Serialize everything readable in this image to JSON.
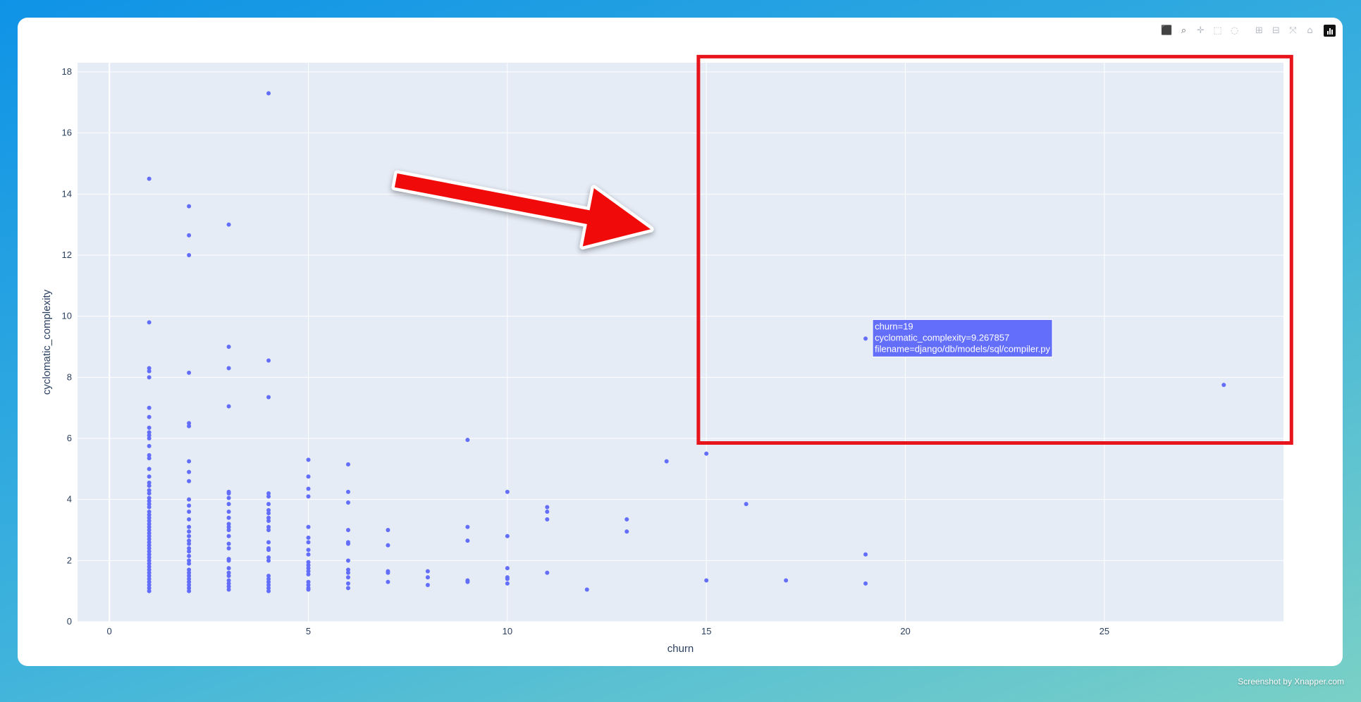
{
  "modebar": {
    "buttons": [
      {
        "name": "camera-icon",
        "glyph": "⬛"
      },
      {
        "name": "zoom-icon",
        "glyph": "⌕"
      },
      {
        "name": "pan-icon",
        "glyph": "✛"
      },
      {
        "name": "box-select-icon",
        "glyph": "⬚"
      },
      {
        "name": "lasso-select-icon",
        "glyph": "◌"
      },
      {
        "name": "zoom-in-icon",
        "glyph": "⊞"
      },
      {
        "name": "zoom-out-icon",
        "glyph": "⊟"
      },
      {
        "name": "autoscale-icon",
        "glyph": "⤧"
      },
      {
        "name": "reset-axes-icon",
        "glyph": "⌂"
      }
    ],
    "logo_icon": "plotly-logo-icon"
  },
  "chart_data": {
    "type": "scatter",
    "xlabel": "churn",
    "ylabel": "cyclomatic_complexity",
    "xlim": [
      -0.8,
      29.5
    ],
    "ylim": [
      0,
      18.3
    ],
    "xticks": [
      0,
      5,
      10,
      15,
      20,
      25
    ],
    "yticks": [
      0,
      2,
      4,
      6,
      8,
      10,
      12,
      14,
      16,
      18
    ],
    "grid": true,
    "marker_color": "#636efa",
    "plot_bg": "#e5ecf6",
    "points": [
      [
        1,
        14.5
      ],
      [
        1,
        9.8
      ],
      [
        1,
        8.3
      ],
      [
        1,
        8.2
      ],
      [
        1,
        8.0
      ],
      [
        1,
        7.0
      ],
      [
        1,
        6.7
      ],
      [
        1,
        6.35
      ],
      [
        1,
        6.2
      ],
      [
        1,
        6.1
      ],
      [
        1,
        6.0
      ],
      [
        1,
        5.75
      ],
      [
        1,
        5.45
      ],
      [
        1,
        5.35
      ],
      [
        1,
        5.0
      ],
      [
        1,
        4.75
      ],
      [
        1,
        4.55
      ],
      [
        1,
        4.45
      ],
      [
        1,
        4.3
      ],
      [
        1,
        4.2
      ],
      [
        1,
        4.05
      ],
      [
        1,
        3.95
      ],
      [
        1,
        3.85
      ],
      [
        1,
        3.75
      ],
      [
        1,
        3.6
      ],
      [
        1,
        3.5
      ],
      [
        1,
        3.4
      ],
      [
        1,
        3.3
      ],
      [
        1,
        3.2
      ],
      [
        1,
        3.1
      ],
      [
        1,
        3.0
      ],
      [
        1,
        2.9
      ],
      [
        1,
        2.8
      ],
      [
        1,
        2.7
      ],
      [
        1,
        2.6
      ],
      [
        1,
        2.5
      ],
      [
        1,
        2.4
      ],
      [
        1,
        2.3
      ],
      [
        1,
        2.2
      ],
      [
        1,
        2.1
      ],
      [
        1,
        2.0
      ],
      [
        1,
        1.9
      ],
      [
        1,
        1.8
      ],
      [
        1,
        1.7
      ],
      [
        1,
        1.6
      ],
      [
        1,
        1.5
      ],
      [
        1,
        1.4
      ],
      [
        1,
        1.3
      ],
      [
        1,
        1.2
      ],
      [
        1,
        1.1
      ],
      [
        1,
        1.0
      ],
      [
        2,
        13.6
      ],
      [
        2,
        12.65
      ],
      [
        2,
        12.0
      ],
      [
        2,
        8.15
      ],
      [
        2,
        6.5
      ],
      [
        2,
        6.4
      ],
      [
        2,
        5.25
      ],
      [
        2,
        4.9
      ],
      [
        2,
        4.6
      ],
      [
        2,
        4.0
      ],
      [
        2,
        3.8
      ],
      [
        2,
        3.6
      ],
      [
        2,
        3.35
      ],
      [
        2,
        3.1
      ],
      [
        2,
        2.95
      ],
      [
        2,
        2.8
      ],
      [
        2,
        2.65
      ],
      [
        2,
        2.55
      ],
      [
        2,
        2.4
      ],
      [
        2,
        2.3
      ],
      [
        2,
        2.15
      ],
      [
        2,
        2.0
      ],
      [
        2,
        1.9
      ],
      [
        2,
        1.7
      ],
      [
        2,
        1.6
      ],
      [
        2,
        1.5
      ],
      [
        2,
        1.4
      ],
      [
        2,
        1.3
      ],
      [
        2,
        1.2
      ],
      [
        2,
        1.1
      ],
      [
        2,
        1.0
      ],
      [
        3,
        13.0
      ],
      [
        3,
        9.0
      ],
      [
        3,
        8.3
      ],
      [
        3,
        7.05
      ],
      [
        3,
        4.25
      ],
      [
        3,
        4.2
      ],
      [
        3,
        4.05
      ],
      [
        3,
        3.85
      ],
      [
        3,
        3.6
      ],
      [
        3,
        3.4
      ],
      [
        3,
        3.2
      ],
      [
        3,
        3.1
      ],
      [
        3,
        3.0
      ],
      [
        3,
        2.8
      ],
      [
        3,
        2.55
      ],
      [
        3,
        2.4
      ],
      [
        3,
        2.05
      ],
      [
        3,
        2.0
      ],
      [
        3,
        1.75
      ],
      [
        3,
        1.6
      ],
      [
        3,
        1.5
      ],
      [
        3,
        1.35
      ],
      [
        3,
        1.25
      ],
      [
        3,
        1.15
      ],
      [
        3,
        1.05
      ],
      [
        4,
        17.3
      ],
      [
        4,
        8.55
      ],
      [
        4,
        7.35
      ],
      [
        4,
        4.2
      ],
      [
        4,
        4.1
      ],
      [
        4,
        3.85
      ],
      [
        4,
        3.65
      ],
      [
        4,
        3.55
      ],
      [
        4,
        3.4
      ],
      [
        4,
        3.3
      ],
      [
        4,
        3.1
      ],
      [
        4,
        3.0
      ],
      [
        4,
        2.6
      ],
      [
        4,
        2.4
      ],
      [
        4,
        2.35
      ],
      [
        4,
        2.1
      ],
      [
        4,
        2.0
      ],
      [
        4,
        1.5
      ],
      [
        4,
        1.4
      ],
      [
        4,
        1.3
      ],
      [
        4,
        1.2
      ],
      [
        4,
        1.1
      ],
      [
        4,
        1.0
      ],
      [
        5,
        5.3
      ],
      [
        5,
        4.75
      ],
      [
        5,
        4.35
      ],
      [
        5,
        4.1
      ],
      [
        5,
        3.1
      ],
      [
        5,
        2.75
      ],
      [
        5,
        2.6
      ],
      [
        5,
        2.35
      ],
      [
        5,
        2.2
      ],
      [
        5,
        1.95
      ],
      [
        5,
        1.85
      ],
      [
        5,
        1.75
      ],
      [
        5,
        1.65
      ],
      [
        5,
        1.55
      ],
      [
        5,
        1.3
      ],
      [
        5,
        1.2
      ],
      [
        5,
        1.1
      ],
      [
        5,
        1.05
      ],
      [
        6,
        5.15
      ],
      [
        6,
        4.25
      ],
      [
        6,
        3.9
      ],
      [
        6,
        3.0
      ],
      [
        6,
        2.6
      ],
      [
        6,
        2.55
      ],
      [
        6,
        2.0
      ],
      [
        6,
        1.7
      ],
      [
        6,
        1.6
      ],
      [
        6,
        1.45
      ],
      [
        6,
        1.25
      ],
      [
        6,
        1.1
      ],
      [
        7,
        3.0
      ],
      [
        7,
        2.5
      ],
      [
        7,
        1.65
      ],
      [
        7,
        1.6
      ],
      [
        7,
        1.3
      ],
      [
        8,
        1.65
      ],
      [
        8,
        1.45
      ],
      [
        8,
        1.2
      ],
      [
        9,
        5.95
      ],
      [
        9,
        3.1
      ],
      [
        9,
        2.65
      ],
      [
        9,
        1.35
      ],
      [
        9,
        1.3
      ],
      [
        10,
        4.25
      ],
      [
        10,
        2.8
      ],
      [
        10,
        1.75
      ],
      [
        10,
        1.45
      ],
      [
        10,
        1.4
      ],
      [
        10,
        1.25
      ],
      [
        11,
        3.75
      ],
      [
        11,
        3.6
      ],
      [
        11,
        3.35
      ],
      [
        11,
        1.6
      ],
      [
        12,
        1.05
      ],
      [
        13,
        3.35
      ],
      [
        13,
        2.95
      ],
      [
        14,
        5.25
      ],
      [
        15,
        5.5
      ],
      [
        15,
        1.35
      ],
      [
        16,
        3.85
      ],
      [
        17,
        1.35
      ],
      [
        19,
        9.267857
      ],
      [
        19,
        2.2
      ],
      [
        19,
        1.25
      ],
      [
        28,
        7.75
      ]
    ],
    "hover": {
      "x": 19,
      "y": 9.267857,
      "lines": [
        "churn=19",
        "cyclomatic_complexity=9.267857",
        "filename=django/db/models/sql/compiler.py"
      ]
    },
    "annotations": {
      "highlight_box": {
        "x0": 14.8,
        "x1": 29.7,
        "y0": 5.85,
        "y1": 18.5,
        "color": "#e8141b"
      },
      "arrow": {
        "from": [
          7.2,
          14.45
        ],
        "to": [
          13.6,
          12.85
        ],
        "color": "#f10a0a"
      }
    }
  },
  "footer": {
    "credit": "Screenshot by Xnapper.com"
  }
}
